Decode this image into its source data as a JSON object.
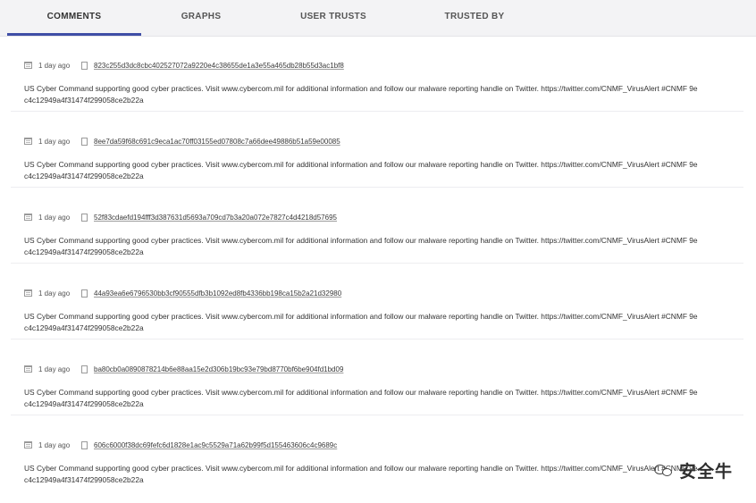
{
  "tabs": [
    {
      "label": "COMMENTS"
    },
    {
      "label": "GRAPHS"
    },
    {
      "label": "USER TRUSTS"
    },
    {
      "label": "TRUSTED BY"
    }
  ],
  "comments": [
    {
      "age": "1 day ago",
      "hash": "823c255d3dc8cbc402527072a9220e4c38655de1a3e55a465db28b55d3ac1bf8",
      "line1": "US Cyber Command supporting good cyber practices. Visit www.cybercom.mil for additional information and follow our malware reporting handle on Twitter. https://twitter.com/CNMF_VirusAlert #CNMF 9e",
      "line2": "c4c12949a4f31474f299058ce2b22a"
    },
    {
      "age": "1 day ago",
      "hash": "8ee7da59f68c691c9eca1ac70ff03155ed07808c7a66dee49886b51a59e00085",
      "line1": "US Cyber Command supporting good cyber practices. Visit www.cybercom.mil for additional information and follow our malware reporting handle on Twitter. https://twitter.com/CNMF_VirusAlert #CNMF 9e",
      "line2": "c4c12949a4f31474f299058ce2b22a"
    },
    {
      "age": "1 day ago",
      "hash": "52f83cdaefd194fff3d387631d5693a709cd7b3a20a072e7827c4d4218d57695",
      "line1": "US Cyber Command supporting good cyber practices. Visit www.cybercom.mil for additional information and follow our malware reporting handle on Twitter. https://twitter.com/CNMF_VirusAlert #CNMF 9e",
      "line2": "c4c12949a4f31474f299058ce2b22a"
    },
    {
      "age": "1 day ago",
      "hash": "44a93ea6e6796530bb3cf90555dfb3b1092ed8fb4336bb198ca15b2a21d32980",
      "line1": "US Cyber Command supporting good cyber practices. Visit www.cybercom.mil for additional information and follow our malware reporting handle on Twitter. https://twitter.com/CNMF_VirusAlert #CNMF 9e",
      "line2": "c4c12949a4f31474f299058ce2b22a"
    },
    {
      "age": "1 day ago",
      "hash": "ba80cb0a0890878214b6e88aa15e2d306b19bc93e79bd8770bf6be904fd1bd09",
      "line1": "US Cyber Command supporting good cyber practices. Visit www.cybercom.mil for additional information and follow our malware reporting handle on Twitter. https://twitter.com/CNMF_VirusAlert #CNMF 9e",
      "line2": "c4c12949a4f31474f299058ce2b22a"
    },
    {
      "age": "1 day ago",
      "hash": "606c6000f38dc69fefc6d1828e1ac9c5529a71a62b99f5d155463606c4c9689c",
      "line1": "US Cyber Command supporting good cyber practices. Visit www.cybercom.mil for additional information and follow our malware reporting handle on Twitter. https://twitter.com/CNMF_VirusAlert #CNMF 9e",
      "line2": "c4c12949a4f31474f299058ce2b22a"
    }
  ],
  "icons": {
    "date": "calendar-icon",
    "file": "file-icon",
    "watermark": "wechat-icon"
  },
  "colors": {
    "active_tab_underline": "#3f4ea6",
    "tabbar_background": "#f3f3f5"
  },
  "watermark": {
    "text": "安全牛"
  }
}
